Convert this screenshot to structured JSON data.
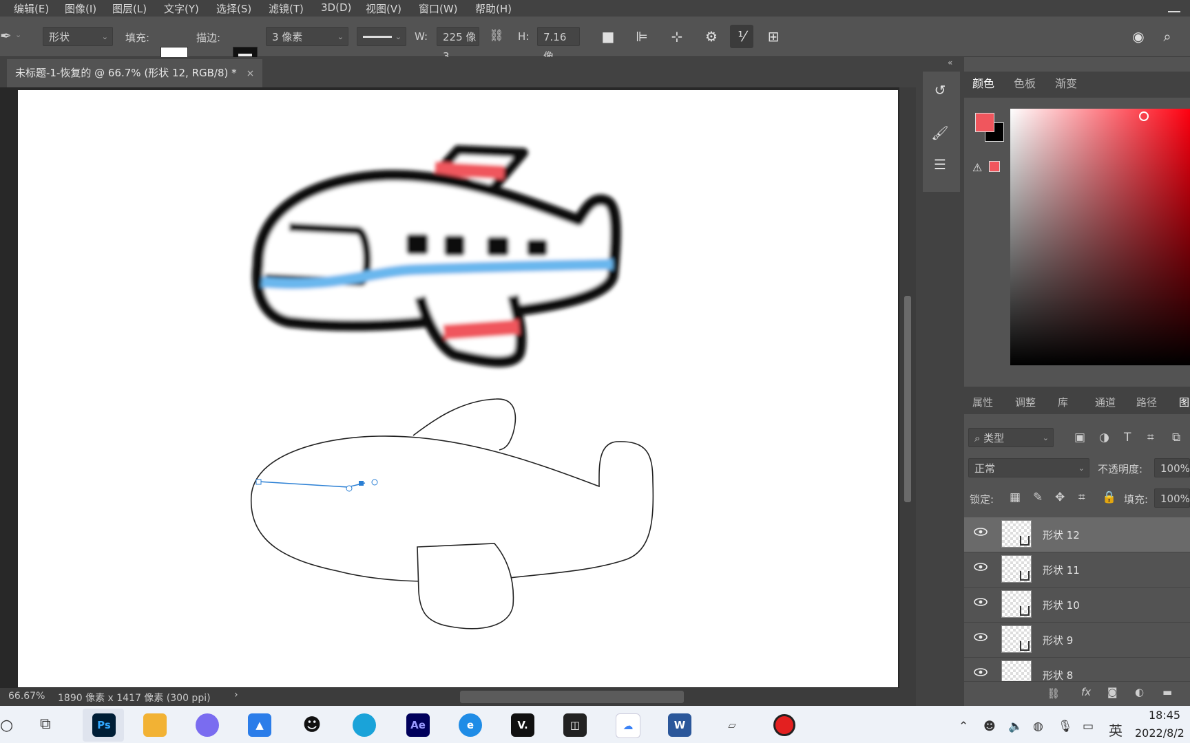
{
  "menu": [
    "编辑(E)",
    "图像(I)",
    "图层(L)",
    "文字(Y)",
    "选择(S)",
    "滤镜(T)",
    "3D(D)",
    "视图(V)",
    "窗口(W)",
    "帮助(H)"
  ],
  "options": {
    "mode": "形状",
    "fill_label": "填充:",
    "stroke_label": "描边:",
    "stroke_size": "3 像素",
    "w_label": "W:",
    "w_value": "225 像3",
    "h_label": "H:",
    "h_value": "7.16 像"
  },
  "document_tab": {
    "title": "未标题-1-恢复的 @ 66.7% (形状 12, RGB/8) *",
    "close": "×"
  },
  "status": {
    "zoom": "66.67%",
    "doc_info": "1890 像素 x 1417 像素 (300 ppi)",
    "arrow": "›"
  },
  "color_panel": {
    "tabs": [
      "颜色",
      "色板",
      "渐变"
    ],
    "foreground": "#f0565d",
    "background": "#000000"
  },
  "layers_panel": {
    "tabs": [
      "属性",
      "调整",
      "库",
      "通道",
      "路径",
      "图"
    ],
    "filter": "类型",
    "blend_mode": "正常",
    "opacity_label": "不透明度:",
    "opacity": "100%",
    "lock_label": "锁定:",
    "fill_label": "填充:",
    "fill": "100%",
    "layers": [
      {
        "name": "形状 12",
        "selected": true
      },
      {
        "name": "形状 11",
        "selected": false
      },
      {
        "name": "形状 10",
        "selected": false
      },
      {
        "name": "形状 9",
        "selected": false
      },
      {
        "name": "形状 8",
        "selected": false
      }
    ],
    "footer": {
      "fx": "fx"
    }
  },
  "taskbar": {
    "apps": [
      "Ps",
      "Ae",
      "V."
    ],
    "ime": "英",
    "time": "18:45",
    "date": "2022/8/2"
  },
  "accent_colors": {
    "red": "#f0565d",
    "blue": "#6ab7ee"
  }
}
